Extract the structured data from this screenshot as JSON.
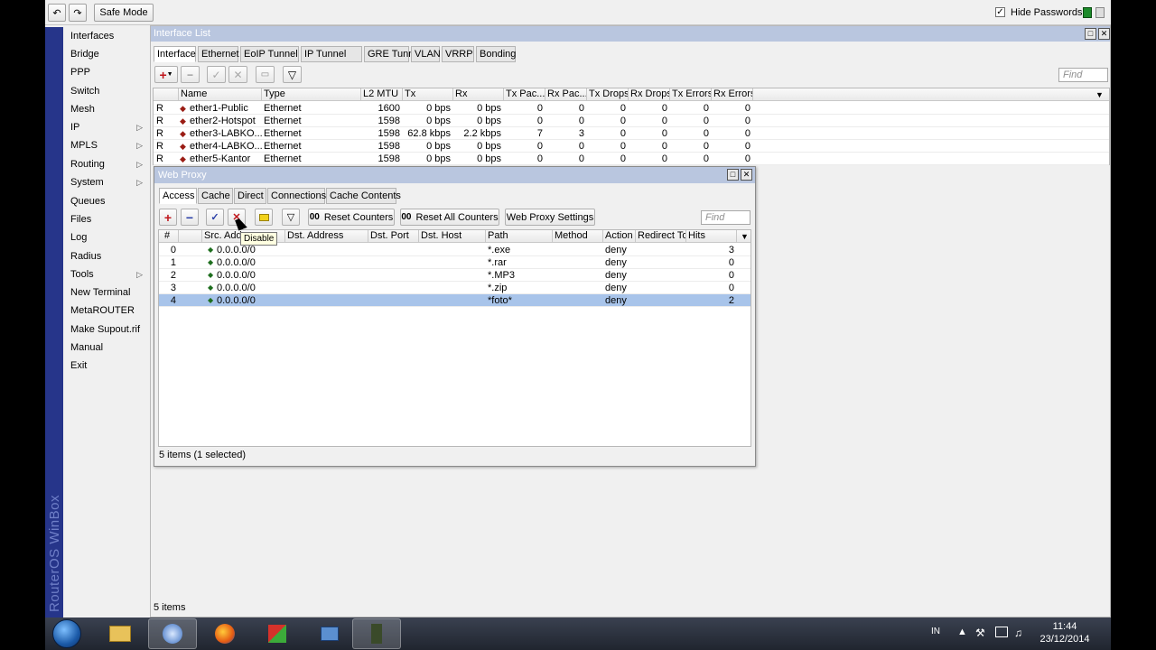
{
  "toolbar": {
    "safe_mode_label": "Safe Mode",
    "hide_passwords_label": "Hide Passwords",
    "hide_passwords_checked": true
  },
  "sidebar": {
    "brand": "RouterOS WinBox",
    "items": [
      {
        "label": "Interfaces",
        "submenu": false
      },
      {
        "label": "Bridge",
        "submenu": false
      },
      {
        "label": "PPP",
        "submenu": false
      },
      {
        "label": "Switch",
        "submenu": false
      },
      {
        "label": "Mesh",
        "submenu": false
      },
      {
        "label": "IP",
        "submenu": true
      },
      {
        "label": "MPLS",
        "submenu": true
      },
      {
        "label": "Routing",
        "submenu": true
      },
      {
        "label": "System",
        "submenu": true
      },
      {
        "label": "Queues",
        "submenu": false
      },
      {
        "label": "Files",
        "submenu": false
      },
      {
        "label": "Log",
        "submenu": false
      },
      {
        "label": "Radius",
        "submenu": false
      },
      {
        "label": "Tools",
        "submenu": true
      },
      {
        "label": "New Terminal",
        "submenu": false
      },
      {
        "label": "MetaROUTER",
        "submenu": false
      },
      {
        "label": "Make Supout.rif",
        "submenu": false
      },
      {
        "label": "Manual",
        "submenu": false
      },
      {
        "label": "Exit",
        "submenu": false
      }
    ]
  },
  "interface_list": {
    "title": "Interface List",
    "tabs": [
      "Interface",
      "Ethernet",
      "EoIP Tunnel",
      "IP Tunnel",
      "GRE Tunnel",
      "VLAN",
      "VRRP",
      "Bonding"
    ],
    "active_tab": "Interface",
    "find_placeholder": "Find",
    "columns": [
      "Name",
      "Type",
      "L2 MTU",
      "Tx",
      "Rx",
      "Tx Pac...",
      "Rx Pac...",
      "Tx Drops",
      "Rx Drops",
      "Tx Errors",
      "Rx Errors"
    ],
    "rows": [
      {
        "flag": "R",
        "name": "ether1-Public",
        "type": "Ethernet",
        "l2mtu": "1600",
        "tx": "0 bps",
        "rx": "0 bps",
        "txpac": "0",
        "rxpac": "0",
        "txdrops": "0",
        "rxdrops": "0",
        "txerr": "0",
        "rxerr": "0"
      },
      {
        "flag": "R",
        "name": "ether2-Hotspot",
        "type": "Ethernet",
        "l2mtu": "1598",
        "tx": "0 bps",
        "rx": "0 bps",
        "txpac": "0",
        "rxpac": "0",
        "txdrops": "0",
        "rxdrops": "0",
        "txerr": "0",
        "rxerr": "0"
      },
      {
        "flag": "R",
        "name": "ether3-LABKO...",
        "type": "Ethernet",
        "l2mtu": "1598",
        "tx": "62.8 kbps",
        "rx": "2.2 kbps",
        "txpac": "7",
        "rxpac": "3",
        "txdrops": "0",
        "rxdrops": "0",
        "txerr": "0",
        "rxerr": "0"
      },
      {
        "flag": "R",
        "name": "ether4-LABKO...",
        "type": "Ethernet",
        "l2mtu": "1598",
        "tx": "0 bps",
        "rx": "0 bps",
        "txpac": "0",
        "rxpac": "0",
        "txdrops": "0",
        "rxdrops": "0",
        "txerr": "0",
        "rxerr": "0"
      },
      {
        "flag": "R",
        "name": "ether5-Kantor",
        "type": "Ethernet",
        "l2mtu": "1598",
        "tx": "0 bps",
        "rx": "0 bps",
        "txpac": "0",
        "rxpac": "0",
        "txdrops": "0",
        "rxdrops": "0",
        "txerr": "0",
        "rxerr": "0"
      }
    ],
    "status": "5 items"
  },
  "web_proxy": {
    "title": "Web Proxy",
    "tabs": [
      "Access",
      "Cache",
      "Direct",
      "Connections",
      "Cache Contents"
    ],
    "active_tab": "Access",
    "reset_counters_label": "Reset Counters",
    "reset_all_counters_label": "Reset All Counters",
    "settings_label": "Web Proxy Settings",
    "counter_prefix": "00",
    "find_placeholder": "Find",
    "tooltip": "Disable",
    "columns": [
      "#",
      "Src. Address",
      "Dst. Address",
      "Dst. Port",
      "Dst. Host",
      "Path",
      "Method",
      "Action",
      "Redirect To",
      "Hits"
    ],
    "rows": [
      {
        "num": "0",
        "src": "0.0.0.0/0",
        "path": "*.exe",
        "action": "deny",
        "hits": "3",
        "selected": false
      },
      {
        "num": "1",
        "src": "0.0.0.0/0",
        "path": "*.rar",
        "action": "deny",
        "hits": "0",
        "selected": false
      },
      {
        "num": "2",
        "src": "0.0.0.0/0",
        "path": "*.MP3",
        "action": "deny",
        "hits": "0",
        "selected": false
      },
      {
        "num": "3",
        "src": "0.0.0.0/0",
        "path": "*.zip",
        "action": "deny",
        "hits": "0",
        "selected": false
      },
      {
        "num": "4",
        "src": "0.0.0.0/0",
        "path": "*foto*",
        "action": "deny",
        "hits": "2",
        "selected": true
      }
    ],
    "status": "5 items (1 selected)"
  },
  "taskbar": {
    "lang": "IN",
    "time": "11:44",
    "date": "23/12/2014"
  },
  "colors": {
    "title_bar": "#b9c6df",
    "brand_bar": "#26358a",
    "selected_row": "#a8c4ea",
    "add_red": "#c0161c",
    "remove_blue": "#2a3fa8"
  }
}
